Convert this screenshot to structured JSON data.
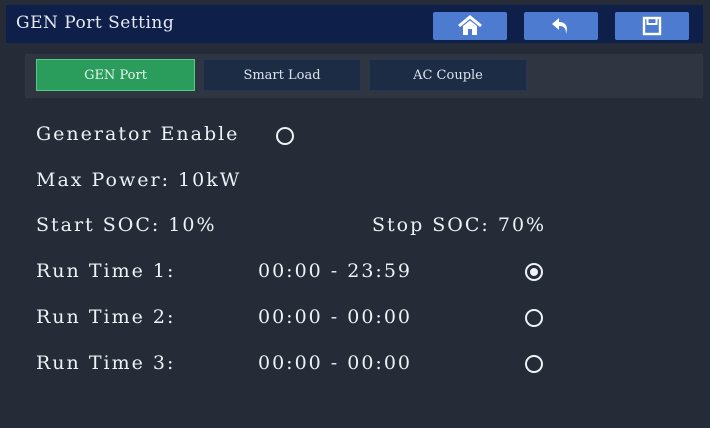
{
  "header": {
    "title": "GEN Port Setting",
    "home_icon": "home-icon",
    "back_icon": "back-arrow-icon",
    "save_icon": "save-icon",
    "accent": "#4d7bd0"
  },
  "tabs": [
    {
      "label": "GEN Port",
      "active": true
    },
    {
      "label": "Smart Load",
      "active": false
    },
    {
      "label": "AC Couple",
      "active": false
    }
  ],
  "settings": {
    "generator_enable_label": "Generator Enable",
    "generator_enable_checked": false,
    "max_power": "Max Power: 10kW",
    "start_soc": "Start SOC: 10%",
    "stop_soc": "Stop SOC: 70%",
    "run_times": [
      {
        "label": "Run Time 1:",
        "range": "00:00 - 23:59",
        "checked": true
      },
      {
        "label": "Run Time 2:",
        "range": "00:00 - 00:00",
        "checked": false
      },
      {
        "label": "Run Time 3:",
        "range": "00:00 - 00:00",
        "checked": false
      }
    ]
  }
}
